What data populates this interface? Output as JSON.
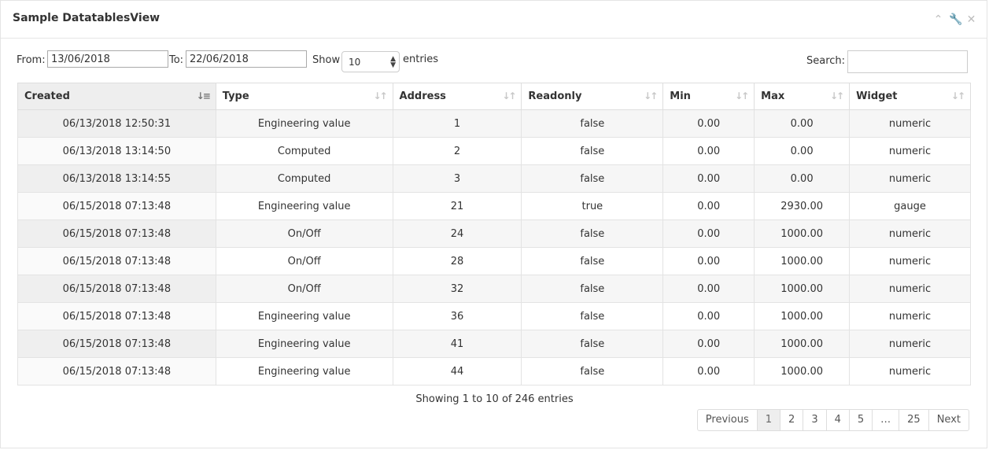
{
  "panel": {
    "title": "Sample DatatablesView",
    "tools": {
      "collapse_icon": "chevron-up-icon",
      "settings_icon": "wrench-icon",
      "close_icon": "close-icon"
    }
  },
  "filters": {
    "from_label": "From:",
    "from_value": "13/06/2018",
    "to_label": "To:",
    "to_value": "22/06/2018",
    "show_label": "Show",
    "page_size": "10",
    "entries_label": "entries",
    "search_label": "Search:",
    "search_value": ""
  },
  "table": {
    "columns": [
      "Created",
      "Type",
      "Address",
      "Readonly",
      "Min",
      "Max",
      "Widget"
    ],
    "sorted_column": "Created",
    "rows": [
      [
        "06/13/2018 12:50:31",
        "Engineering value",
        "1",
        "false",
        "0.00",
        "0.00",
        "numeric"
      ],
      [
        "06/13/2018 13:14:50",
        "Computed",
        "2",
        "false",
        "0.00",
        "0.00",
        "numeric"
      ],
      [
        "06/13/2018 13:14:55",
        "Computed",
        "3",
        "false",
        "0.00",
        "0.00",
        "numeric"
      ],
      [
        "06/15/2018 07:13:48",
        "Engineering value",
        "21",
        "true",
        "0.00",
        "2930.00",
        "gauge"
      ],
      [
        "06/15/2018 07:13:48",
        "On/Off",
        "24",
        "false",
        "0.00",
        "1000.00",
        "numeric"
      ],
      [
        "06/15/2018 07:13:48",
        "On/Off",
        "28",
        "false",
        "0.00",
        "1000.00",
        "numeric"
      ],
      [
        "06/15/2018 07:13:48",
        "On/Off",
        "32",
        "false",
        "0.00",
        "1000.00",
        "numeric"
      ],
      [
        "06/15/2018 07:13:48",
        "Engineering value",
        "36",
        "false",
        "0.00",
        "1000.00",
        "numeric"
      ],
      [
        "06/15/2018 07:13:48",
        "Engineering value",
        "41",
        "false",
        "0.00",
        "1000.00",
        "numeric"
      ],
      [
        "06/15/2018 07:13:48",
        "Engineering value",
        "44",
        "false",
        "0.00",
        "1000.00",
        "numeric"
      ]
    ]
  },
  "info": "Showing 1 to 10 of 246 entries",
  "pagination": {
    "previous": "Previous",
    "pages": [
      "1",
      "2",
      "3",
      "4",
      "5",
      "…",
      "25"
    ],
    "active_page": "1",
    "next": "Next"
  }
}
